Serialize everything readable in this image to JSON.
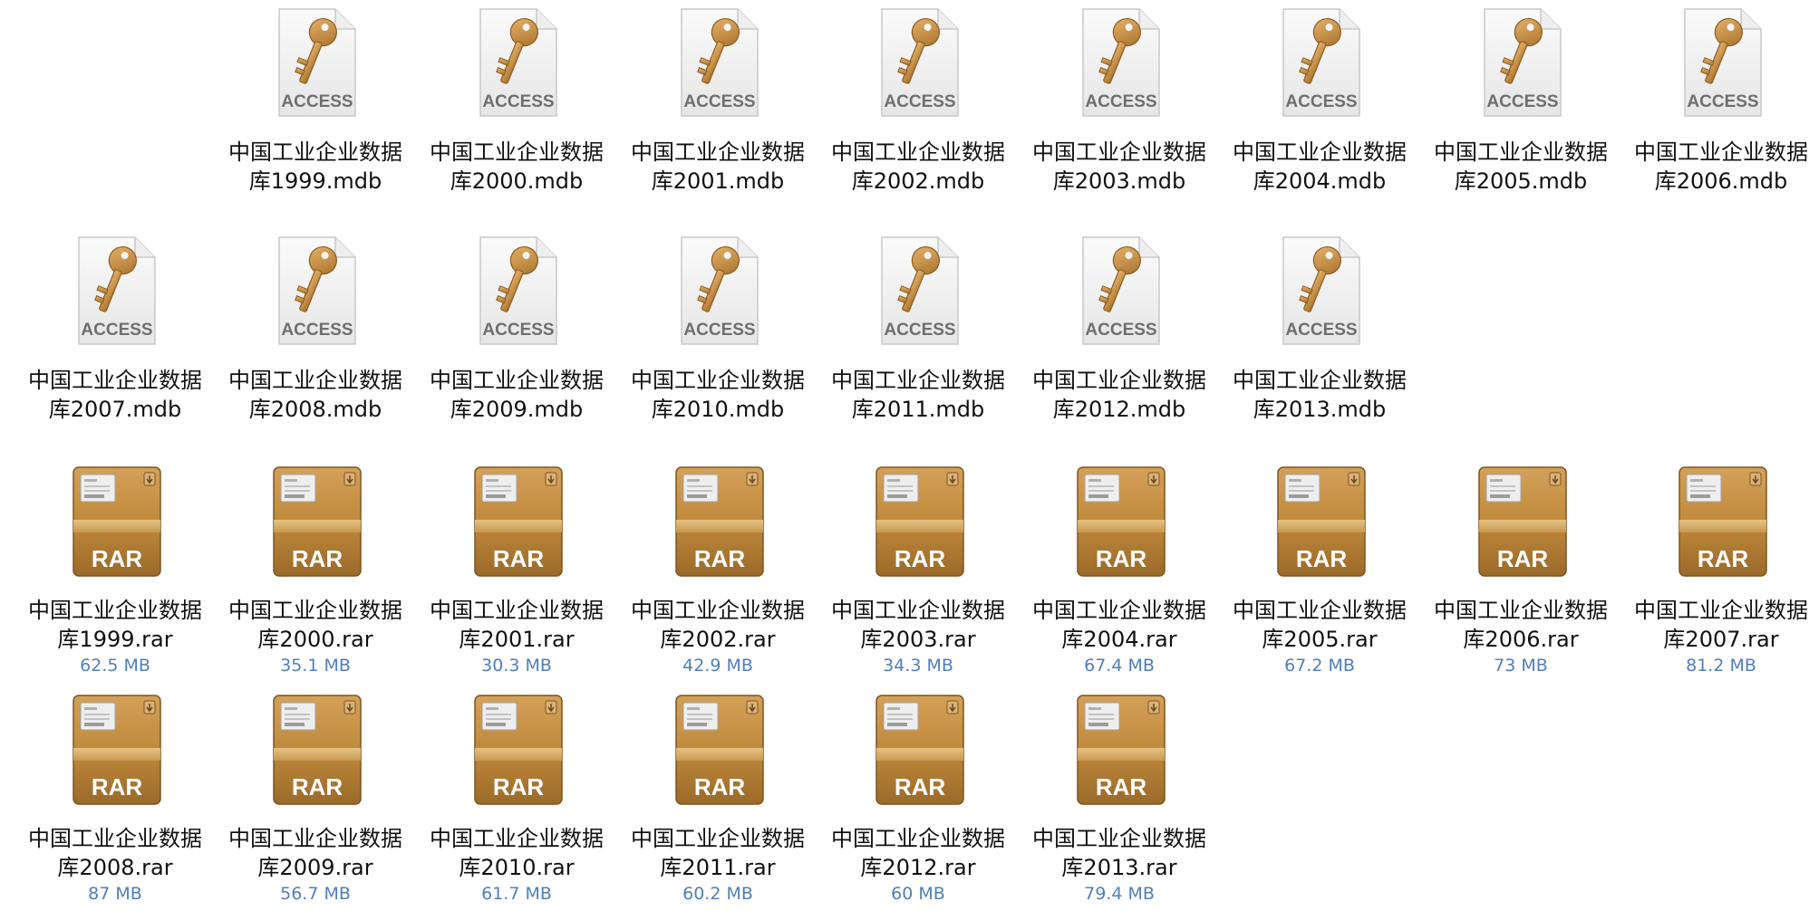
{
  "colors": {
    "label_text": "#111111",
    "size_text": "#4f7fbd",
    "access_key": "#c99448",
    "rar_box": "#c08a3c"
  },
  "files": [
    {
      "line1": "中国工业企业数据",
      "line2": "库1999.mdb",
      "kind": "access",
      "icon": "access-key-icon",
      "icon_text": "ACCESS",
      "size": ""
    },
    {
      "line1": "中国工业企业数据",
      "line2": "库2000.mdb",
      "kind": "access",
      "icon": "access-key-icon",
      "icon_text": "ACCESS",
      "size": ""
    },
    {
      "line1": "中国工业企业数据",
      "line2": "库2001.mdb",
      "kind": "access",
      "icon": "access-key-icon",
      "icon_text": "ACCESS",
      "size": ""
    },
    {
      "line1": "中国工业企业数据",
      "line2": "库2002.mdb",
      "kind": "access",
      "icon": "access-key-icon",
      "icon_text": "ACCESS",
      "size": ""
    },
    {
      "line1": "中国工业企业数据",
      "line2": "库2003.mdb",
      "kind": "access",
      "icon": "access-key-icon",
      "icon_text": "ACCESS",
      "size": ""
    },
    {
      "line1": "中国工业企业数据",
      "line2": "库2004.mdb",
      "kind": "access",
      "icon": "access-key-icon",
      "icon_text": "ACCESS",
      "size": ""
    },
    {
      "line1": "中国工业企业数据",
      "line2": "库2005.mdb",
      "kind": "access",
      "icon": "access-key-icon",
      "icon_text": "ACCESS",
      "size": ""
    },
    {
      "line1": "中国工业企业数据",
      "line2": "库2006.mdb",
      "kind": "access",
      "icon": "access-key-icon",
      "icon_text": "ACCESS",
      "size": ""
    },
    {
      "line1": "中国工业企业数据",
      "line2": "库2007.mdb",
      "kind": "access",
      "icon": "access-key-icon",
      "icon_text": "ACCESS",
      "size": ""
    },
    {
      "line1": "中国工业企业数据",
      "line2": "库2008.mdb",
      "kind": "access",
      "icon": "access-key-icon",
      "icon_text": "ACCESS",
      "size": ""
    },
    {
      "line1": "中国工业企业数据",
      "line2": "库2009.mdb",
      "kind": "access",
      "icon": "access-key-icon",
      "icon_text": "ACCESS",
      "size": ""
    },
    {
      "line1": "中国工业企业数据",
      "line2": "库2010.mdb",
      "kind": "access",
      "icon": "access-key-icon",
      "icon_text": "ACCESS",
      "size": ""
    },
    {
      "line1": "中国工业企业数据",
      "line2": "库2011.mdb",
      "kind": "access",
      "icon": "access-key-icon",
      "icon_text": "ACCESS",
      "size": ""
    },
    {
      "line1": "中国工业企业数据",
      "line2": "库2012.mdb",
      "kind": "access",
      "icon": "access-key-icon",
      "icon_text": "ACCESS",
      "size": ""
    },
    {
      "line1": "中国工业企业数据",
      "line2": "库2013.mdb",
      "kind": "access",
      "icon": "access-key-icon",
      "icon_text": "ACCESS",
      "size": ""
    },
    {
      "line1": "中国工业企业数据",
      "line2": "库1999.rar",
      "kind": "rar",
      "icon": "rar-archive-icon",
      "icon_text": "RAR",
      "size": "62.5 MB"
    },
    {
      "line1": "中国工业企业数据",
      "line2": "库2000.rar",
      "kind": "rar",
      "icon": "rar-archive-icon",
      "icon_text": "RAR",
      "size": "35.1 MB"
    },
    {
      "line1": "中国工业企业数据",
      "line2": "库2001.rar",
      "kind": "rar",
      "icon": "rar-archive-icon",
      "icon_text": "RAR",
      "size": "30.3 MB"
    },
    {
      "line1": "中国工业企业数据",
      "line2": "库2002.rar",
      "kind": "rar",
      "icon": "rar-archive-icon",
      "icon_text": "RAR",
      "size": "42.9 MB"
    },
    {
      "line1": "中国工业企业数据",
      "line2": "库2003.rar",
      "kind": "rar",
      "icon": "rar-archive-icon",
      "icon_text": "RAR",
      "size": "34.3 MB"
    },
    {
      "line1": "中国工业企业数据",
      "line2": "库2004.rar",
      "kind": "rar",
      "icon": "rar-archive-icon",
      "icon_text": "RAR",
      "size": "67.4 MB"
    },
    {
      "line1": "中国工业企业数据",
      "line2": "库2005.rar",
      "kind": "rar",
      "icon": "rar-archive-icon",
      "icon_text": "RAR",
      "size": "67.2 MB"
    },
    {
      "line1": "中国工业企业数据",
      "line2": "库2006.rar",
      "kind": "rar",
      "icon": "rar-archive-icon",
      "icon_text": "RAR",
      "size": "73 MB"
    },
    {
      "line1": "中国工业企业数据",
      "line2": "库2007.rar",
      "kind": "rar",
      "icon": "rar-archive-icon",
      "icon_text": "RAR",
      "size": "81.2 MB"
    },
    {
      "line1": "中国工业企业数据",
      "line2": "库2008.rar",
      "kind": "rar",
      "icon": "rar-archive-icon",
      "icon_text": "RAR",
      "size": "87 MB"
    },
    {
      "line1": "中国工业企业数据",
      "line2": "库2009.rar",
      "kind": "rar",
      "icon": "rar-archive-icon",
      "icon_text": "RAR",
      "size": "56.7 MB"
    },
    {
      "line1": "中国工业企业数据",
      "line2": "库2010.rar",
      "kind": "rar",
      "icon": "rar-archive-icon",
      "icon_text": "RAR",
      "size": "61.7 MB"
    },
    {
      "line1": "中国工业企业数据",
      "line2": "库2011.rar",
      "kind": "rar",
      "icon": "rar-archive-icon",
      "icon_text": "RAR",
      "size": "60.2 MB"
    },
    {
      "line1": "中国工业企业数据",
      "line2": "库2012.rar",
      "kind": "rar",
      "icon": "rar-archive-icon",
      "icon_text": "RAR",
      "size": "60 MB"
    },
    {
      "line1": "中国工业企业数据",
      "line2": "库2013.rar",
      "kind": "rar",
      "icon": "rar-archive-icon",
      "icon_text": "RAR",
      "size": "79.4 MB"
    }
  ]
}
